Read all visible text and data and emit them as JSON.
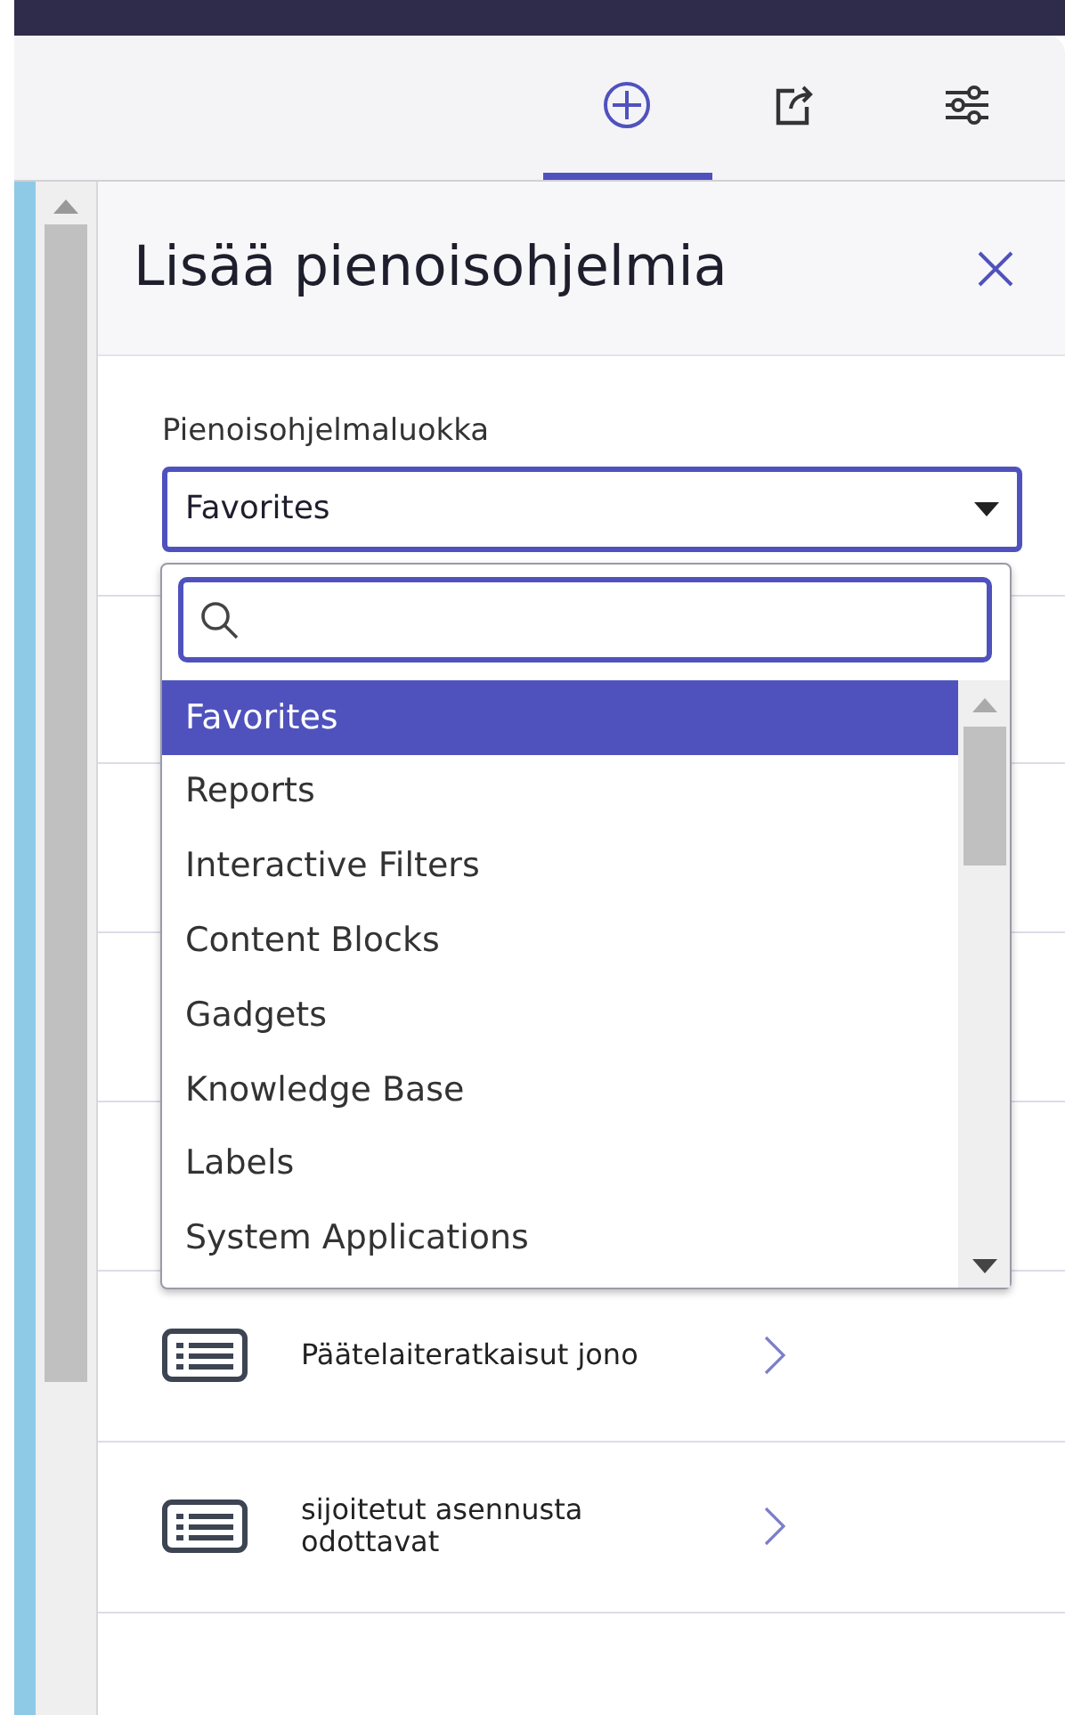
{
  "toolbar": {
    "tabs": [
      {
        "kind": "add",
        "selected": true
      },
      {
        "kind": "share",
        "selected": false
      },
      {
        "kind": "settings",
        "selected": false
      }
    ]
  },
  "panel": {
    "title": "Lisää pienoisohjelmia",
    "category": {
      "label": "Pienoisohjelmaluokka",
      "value": "Favorites",
      "expanded": true,
      "options": [
        {
          "label": "Favorites",
          "selected": true
        },
        {
          "label": "Reports",
          "selected": false
        },
        {
          "label": "Interactive Filters",
          "selected": false
        },
        {
          "label": "Content Blocks",
          "selected": false
        },
        {
          "label": "Gadgets",
          "selected": false
        },
        {
          "label": "Knowledge Base",
          "selected": false
        },
        {
          "label": "Labels",
          "selected": false
        },
        {
          "label": "System Applications",
          "selected": false
        }
      ]
    },
    "widgets": [
      {
        "name": "Päätelaiteratkaisut jono"
      },
      {
        "name": "sijoitetut asennusta odottavat"
      }
    ]
  }
}
